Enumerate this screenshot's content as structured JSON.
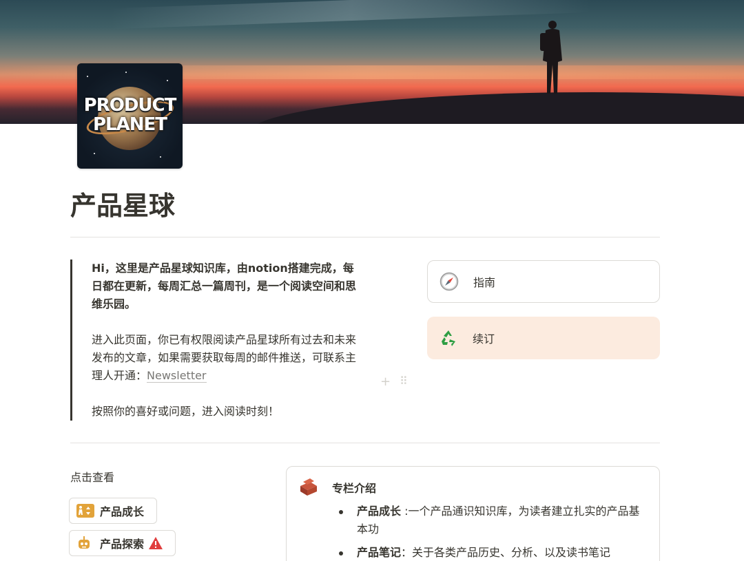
{
  "cover": {
    "image": "sunset-silhouette-cover"
  },
  "logo": {
    "line1": "PRODUCT",
    "line2": "PLANET"
  },
  "page": {
    "title": "产品星球"
  },
  "intro": {
    "p1": "Hi，这里是产品星球知识库，由notion搭建完成，每日都在更新，每周汇总一篇周刊，是一个阅读空间和思维乐园。",
    "p2_text": "进入此页面，你已有权限阅读产品星球所有过去和未来发布的文章，如果需要获取每周的邮件推送，可联系主理人开通：",
    "p2_link": "Newsletter",
    "p3": "按照你的喜好或问题，进入阅读时刻！"
  },
  "callouts": [
    {
      "label": "指南",
      "icon": "compass-icon"
    },
    {
      "label": "续订",
      "icon": "recycle-icon"
    }
  ],
  "nav": {
    "label": "点击查看",
    "chips": [
      {
        "label": "产品成长",
        "icon": "escalator-icon"
      },
      {
        "label": "产品探索",
        "icon": "robot-icon",
        "badge": "warning-icon"
      }
    ]
  },
  "column": {
    "icon": "bricks-icon",
    "title": "专栏介绍",
    "items": [
      {
        "term": "产品成长",
        "text": " :一个产品通识知识库，为读者建立扎实的产品基本功"
      },
      {
        "term": "产品笔记",
        "text": "：关于各类产品历史、分析、以及读书笔记"
      }
    ]
  },
  "colors": {
    "text": "#37352f",
    "muted": "#787774",
    "renew_bg": "#fcebdf",
    "border": "#dcdad6"
  }
}
